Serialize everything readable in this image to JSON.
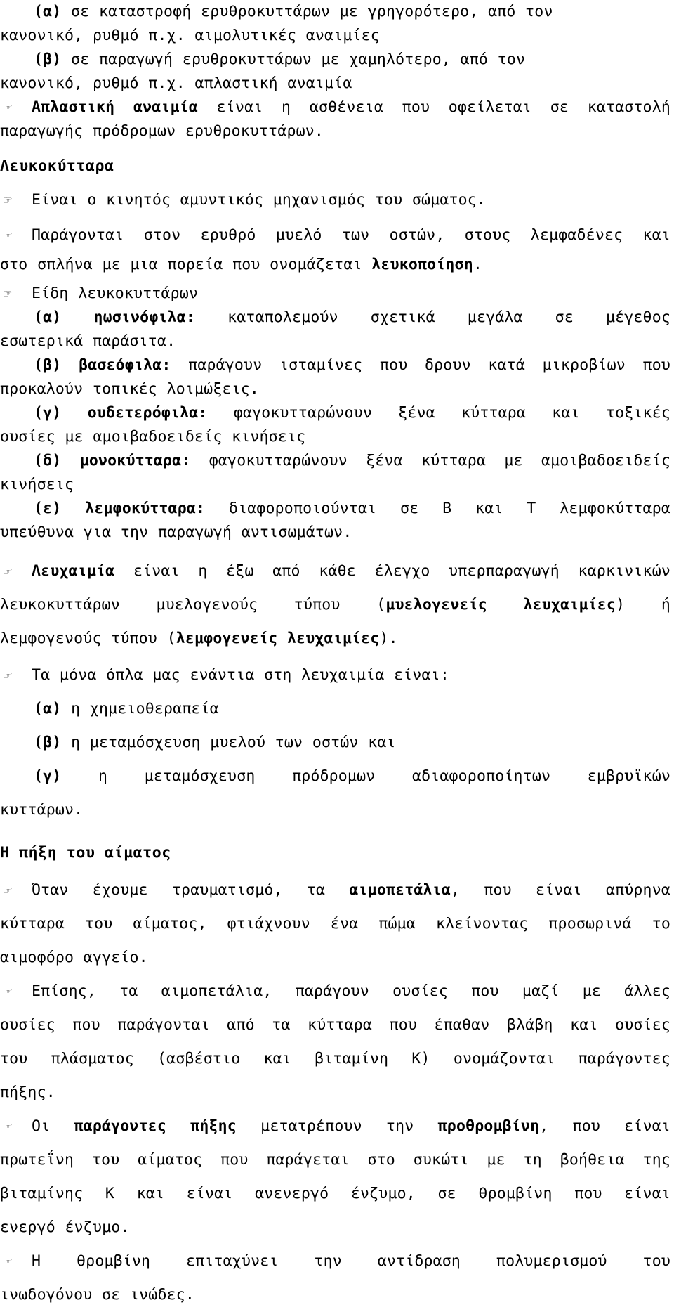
{
  "document": {
    "language": "el",
    "bullet_glyph": "☞",
    "bullet_icon_name": "pointing-hand-bullet-icon",
    "text_color": "#000000",
    "background_color": "#ffffff"
  },
  "anemia_causes": {
    "item_a": {
      "label": "(α)",
      "line1": "σε καταστροφή ερυθροκυττάρων με γρηγορότερο, από τον",
      "line2": "κανονικό, ρυθμό π.χ. αιμολυτικές αναιμίες"
    },
    "item_b": {
      "label": "(β)",
      "line1": "σε παραγωγή ερυθροκυττάρων με χαμηλότερο, από τον",
      "line2": "κανονικό, ρυθμό π.χ. απλαστική αναιμία"
    },
    "aplastic": {
      "term": "Απλαστική αναιμία",
      "line1": "είναι η ασθένεια που οφείλεται σε καταστολή",
      "line2": "παραγωγής πρόδρομων ερυθροκυττάρων."
    }
  },
  "leukocytes": {
    "heading": "Λευκοκύτταρα",
    "bullet_defense": "Είναι ο κινητός αμυντικός μηχανισμός του σώματος.",
    "bullet_production": {
      "line1": "Παράγονται στον ερυθρό μυελό των οστών, στους λεμφαδένες και",
      "line2_pre": "στο σπλήνα με μια πορεία που ονομάζεται ",
      "line2_term": "λευκοποίηση",
      "line2_post": "."
    },
    "types_label": "Είδη λευκοκυττάρων",
    "types": [
      {
        "label": "(α)",
        "term": "ηωσινόφιλα:",
        "line1": "καταπολεμούν σχετικά μεγάλα σε μέγεθος",
        "line2": "εσωτερικά παράσιτα."
      },
      {
        "label": "(β)",
        "term": "βασεόφιλα:",
        "line1": "παράγουν ισταμίνες που δρουν κατά μικροβίων που",
        "line2": "προκαλούν τοπικές λοιμώξεις."
      },
      {
        "label": "(γ)",
        "term": "ουδετερόφιλα:",
        "line1": "φαγοκυτταρώνουν ξένα κύτταρα και τοξικές",
        "line2": "ουσίες με αμοιβαδοειδείς κινήσεις"
      },
      {
        "label": "(δ)",
        "term": "μονοκύτταρα:",
        "line1": "φαγοκυτταρώνουν ξένα κύτταρα με αμοιβαδοειδείς",
        "line2": "κινήσεις"
      },
      {
        "label": "(ε)",
        "term": "λεμφοκύτταρα:",
        "line1": "διαφοροποιούνται σε Β και Τ λεμφοκύτταρα",
        "line2": "υπεύθυνα για την παραγωγή αντισωμάτων."
      }
    ]
  },
  "leukemia": {
    "term": "Λευχαιμία",
    "line1": "είναι η έξω από κάθε έλεγχο υπερπαραγωγή καρκινικών",
    "line2_pre": "λευκοκυττάρων μυελογενούς τύπου (",
    "line2_term": "μυελογενείς λευχαιμίες",
    "line2_post": ") ή",
    "line3_pre": "λεμφογενούς τύπου (",
    "line3_term": "λεμφογενείς λευχαιμίες",
    "line3_post": ").",
    "weapons_intro": "Τα μόνα όπλα μας ενάντια στη λευχαιμία είναι:",
    "weapons": [
      {
        "label": "(α)",
        "text": "η χημειοθεραπεία"
      },
      {
        "label": "(β)",
        "text": "η μεταμόσχευση μυελού των οστών και"
      },
      {
        "label": "(γ)",
        "text": "η μεταμόσχευση πρόδρομων αδιαφοροποίητων εμβρυϊκών",
        "continuation": "κυττάρων."
      }
    ]
  },
  "coagulation": {
    "heading": "Η πήξη του αίματος",
    "platelets": {
      "line1_pre": "Όταν έχουμε τραυματισμό, τα ",
      "line1_term": "αιμοπετάλια",
      "line1_post": ", που είναι απύρηνα",
      "line2": "κύτταρα του αίματος, φτιάχνουν ένα πώμα κλείνοντας προσωρινά το",
      "line3": "αιμοφόρο αγγείο."
    },
    "substances": {
      "line1": "Επίσης, τα αιμοπετάλια, παράγουν ουσίες που μαζί με άλλες",
      "line2": "ουσίες που παράγονται από τα κύτταρα που έπαθαν βλάβη και ουσίες",
      "line3": "του πλάσματος (ασβέστιο και βιταμίνη Κ) ονομάζονται παράγοντες",
      "line4": "πήξης."
    },
    "prothrombin": {
      "line1_pre": "Οι ",
      "line1_term1": "παράγοντες πήξης",
      "line1_mid": " μετατρέπουν την ",
      "line1_term2": "προθρομβίνη",
      "line1_post": ", που είναι",
      "line2": "πρωτεΐνη του αίματος που παράγεται στο συκώτι με τη βοήθεια της",
      "line3": "βιταμίνης Κ και είναι ανενεργό ένζυμο, σε θρομβίνη που είναι",
      "line4": "ενεργό ένζυμο."
    },
    "thrombin": {
      "line1": "Η θρομβίνη επιταχύνει την αντίδραση πολυμερισμού του",
      "line2": "ινωδογόνου σε ινώδες."
    }
  }
}
